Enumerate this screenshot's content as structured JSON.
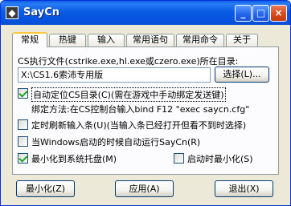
{
  "window": {
    "title": "SayCn",
    "controls": {
      "minimize": "_",
      "maximize": "□",
      "close": "×"
    }
  },
  "tabs": [
    {
      "label": "常规",
      "active": true
    },
    {
      "label": "热键",
      "active": false
    },
    {
      "label": "输入",
      "active": false
    },
    {
      "label": "常用语句",
      "active": false
    },
    {
      "label": "常用命令",
      "active": false
    },
    {
      "label": "关于",
      "active": false
    }
  ],
  "general": {
    "exe_label": "CS执行文件(cstrike.exe,hl.exe或czero.exe)所在目录:",
    "exe_path": "X:\\CS1.6索沛专用版",
    "browse_button": "选择(L)...",
    "auto_locate": {
      "label": "自动定位CS目录(C)(需在游戏中手动绑定发送键)",
      "checked": true
    },
    "bind_method": "绑定方法:在CS控制台输入bind F12 \"exec saycn.cfg\"",
    "refresh_input": {
      "label": "定时刷新输入条(U)(当输入条已经打开但看不到时选择)",
      "checked": false
    },
    "auto_run": {
      "label": "当Windows启动的时候自动运行SayCn(R)",
      "checked": false
    },
    "minimize_tray": {
      "label": "最小化到系统托盘(M)",
      "checked": true
    },
    "start_minimized": {
      "label": "启动时最小化(S)",
      "checked": false
    }
  },
  "buttons": {
    "minimize": "最小化(Z)",
    "apply": "应用(A)",
    "exit": "退出(X)"
  }
}
